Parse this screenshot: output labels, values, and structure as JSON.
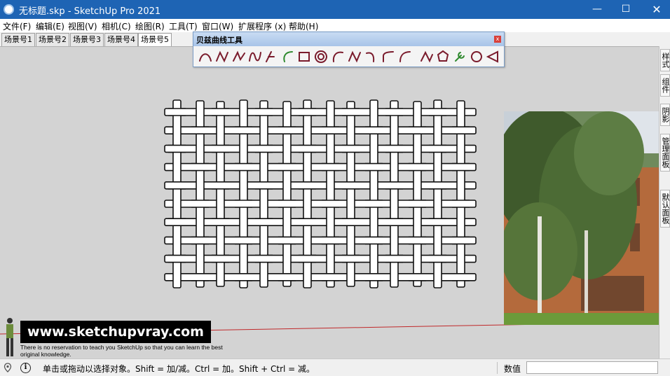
{
  "window": {
    "title": "无标题.skp - SketchUp Pro 2021",
    "minimize_glyph": "—",
    "maximize_glyph": "☐",
    "close_glyph": "✕"
  },
  "menu": {
    "items": [
      "文件(F)",
      "编辑(E)",
      "视图(V)",
      "相机(C)",
      "绘图(R)",
      "工具(T)",
      "窗口(W)",
      "扩展程序 (x)",
      "帮助(H)"
    ]
  },
  "scenes": {
    "tabs": [
      "场景号1",
      "场景号2",
      "场景号3",
      "场景号4",
      "场景号5"
    ],
    "active_index": 4
  },
  "bezier_toolbar": {
    "title": "贝兹曲线工具",
    "close_glyph": "x",
    "tools": [
      "bezier-arc",
      "bspline",
      "catmull-spline",
      "cubic-bezier",
      "fspline",
      "fit-arc",
      "rectangle",
      "concentric-circles",
      "arc",
      "uniform-bspline",
      "divider",
      "rounded-corner",
      "arc-bezier",
      "polyline",
      "polygon",
      "edit-wrench",
      "circle",
      "cone"
    ],
    "accent_color": "#7a1b2c"
  },
  "right_tray": {
    "tabs": [
      "样式",
      "组件",
      "阴影",
      "管理面板",
      "默认面板"
    ]
  },
  "viewport": {
    "background": "#d3d3d3",
    "watermark": "www.sketchupvray.com",
    "watermark_caption": "There is no reservation to teach you SketchUp so that you can learn the best original knowledge."
  },
  "statusbar": {
    "hint": "单击或拖动以选择对象。Shift = 加/减。Ctrl = 加。Shift + Ctrl = 减。",
    "measurements_label": "数值",
    "measurements_value": "",
    "info_glyph": "i"
  },
  "colors": {
    "titlebar": "#1e64b4",
    "axis_red": "#c0282a"
  }
}
